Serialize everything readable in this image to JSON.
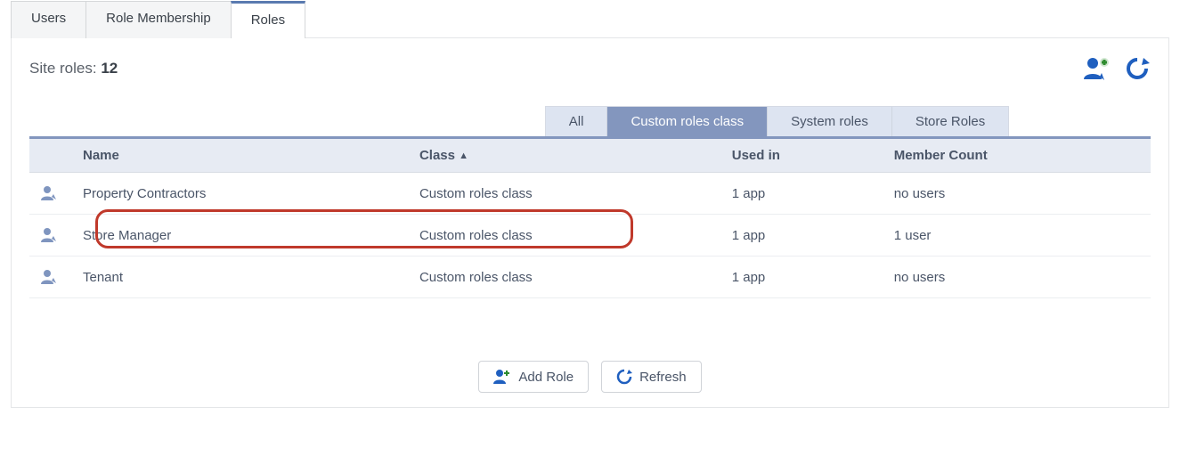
{
  "tabs": {
    "users": "Users",
    "role_membership": "Role Membership",
    "roles": "Roles",
    "active": "roles"
  },
  "header": {
    "site_roles_label": "Site roles:",
    "site_roles_count": "12"
  },
  "filters": {
    "all": "All",
    "custom": "Custom roles class",
    "system": "System roles",
    "store": "Store Roles",
    "active": "custom"
  },
  "columns": {
    "name": "Name",
    "class": "Class",
    "sort_indicator": "▲",
    "used_in": "Used in",
    "member_count": "Member Count"
  },
  "rows": [
    {
      "name": "Property Contractors",
      "class": "Custom roles class",
      "used_in": "1 app",
      "member_count": "no users",
      "muted": true,
      "highlight": false
    },
    {
      "name": "Store Manager",
      "class": "Custom roles class",
      "used_in": "1 app",
      "member_count": "1 user",
      "muted": false,
      "highlight": true
    },
    {
      "name": "Tenant",
      "class": "Custom roles class",
      "used_in": "1 app",
      "member_count": "no users",
      "muted": true,
      "highlight": false
    }
  ],
  "footer": {
    "add_role": "Add Role",
    "refresh": "Refresh"
  }
}
